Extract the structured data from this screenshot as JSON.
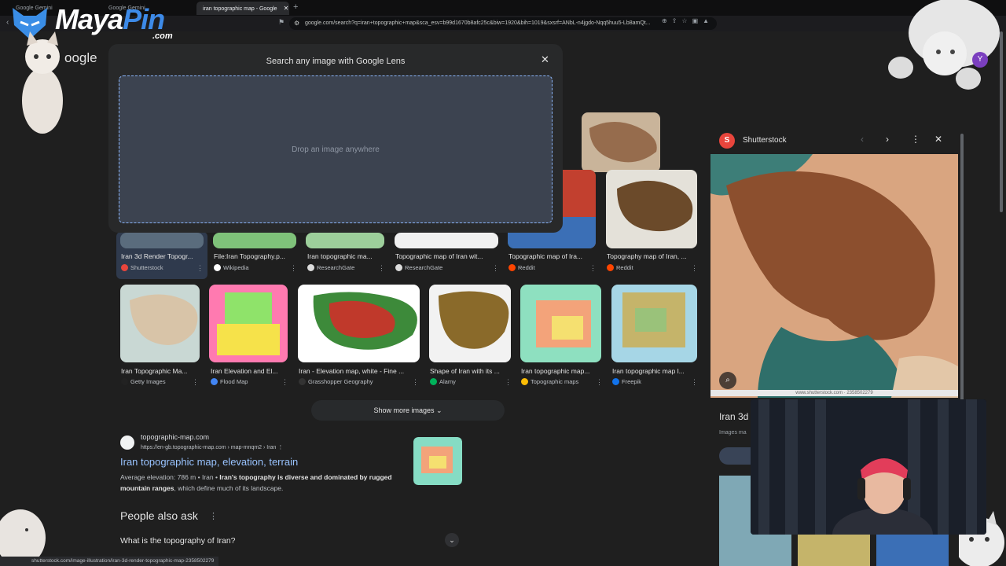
{
  "browser": {
    "tabs": [
      {
        "label": "Google Gemini"
      },
      {
        "label": "Google Gemini"
      },
      {
        "label": "iran topographic map - Google"
      }
    ],
    "url": "google.com/search?q=iran+topographic+map&sca_esv=b99d1670b8afc25c&biw=1920&bih=1019&sxsrf=ANbL-n4jgdo-Nqq5huu5-Lb8amQt..."
  },
  "overlay": {
    "logo_main": "Maya",
    "logo_accent": "Pin",
    "logo_sub": ".com"
  },
  "google_logo": "oogle",
  "lens": {
    "title": "Search any image with Google Lens",
    "drop_text": "Drop an image anywhere"
  },
  "images_row1": [
    {
      "caption": "Iran 3d Render Topogr...",
      "source": "Shutterstock",
      "color": "#e8453c"
    },
    {
      "caption": "File:Iran Topography.p...",
      "source": "Wikipedia",
      "color": "#ffffff"
    },
    {
      "caption": "Iran topographic ma...",
      "source": "ResearchGate",
      "color": "#dcdcdc"
    },
    {
      "caption": "Topographic map of Iran wit...",
      "source": "ResearchGate",
      "color": "#dcdcdc"
    },
    {
      "caption": "Topographic map of Ira...",
      "source": "Reddit",
      "color": "#ff4500"
    },
    {
      "caption": "Topography map of Iran, ...",
      "source": "Reddit",
      "color": "#ff4500"
    }
  ],
  "images_row2": [
    {
      "caption": "Iran Topographic Ma...",
      "source": "Getty Images",
      "color": "#222222"
    },
    {
      "caption": "Iran Elevation and El...",
      "source": "Flood Map",
      "color": "#4285f4"
    },
    {
      "caption": "Iran - Elevation map, white - Fine ...",
      "source": "Grasshopper Geography",
      "color": "#333333"
    },
    {
      "caption": "Shape of Iran with its ...",
      "source": "Alamy",
      "color": "#00b25a"
    },
    {
      "caption": "Iran topographic map...",
      "source": "Topographic maps",
      "color": "#fbbc05"
    },
    {
      "caption": "Iran topographic map l...",
      "source": "Freepik",
      "color": "#1273eb"
    }
  ],
  "show_more": "Show more images",
  "result": {
    "site": "topographic-map.com",
    "url": "https://en-gb.topographic-map.com › map-mnqm2 › Iran",
    "title": "Iran topographic map, elevation, terrain",
    "snippet_a": "Average elevation: 786 m • Iran • ",
    "snippet_b": "Iran's topography is diverse and dominated by rugged mountain ranges",
    "snippet_c": ", which define much of its landscape."
  },
  "paa": {
    "heading": "People also ask",
    "q1": "What is the topography of Iran?"
  },
  "status_url": "shutterstock.com/image-illustration/iran-3d-render-topographic-map-2358502279",
  "panel": {
    "site": "Shutterstock",
    "watermark": "www.shutterstock.com · 2358502279",
    "title": "Iran 3d",
    "subtitle": "Images ma"
  },
  "avatar_letter": "Y"
}
